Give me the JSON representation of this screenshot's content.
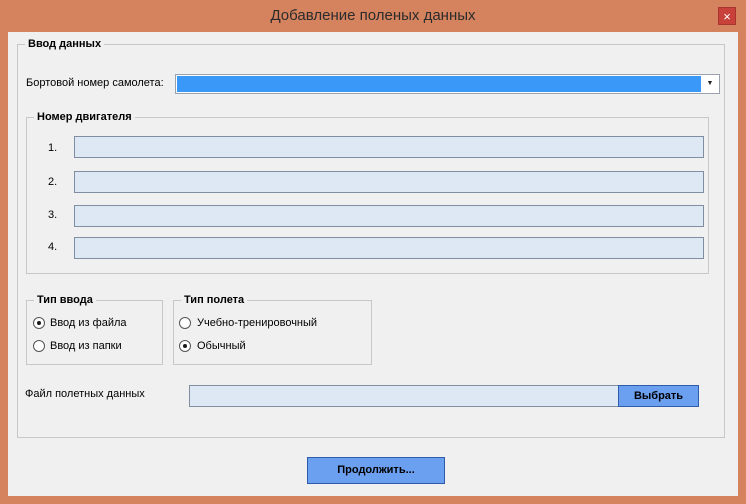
{
  "window": {
    "title": "Добавление поленых данных",
    "close_glyph": "×"
  },
  "input_group": {
    "legend": "Ввод данных",
    "tail_number_label": "Бортовой номер самолета:",
    "tail_number_value": "",
    "dropdown_glyph": "▼"
  },
  "engine_group": {
    "legend": "Номер двигателя",
    "rows": [
      {
        "label": "1.",
        "value": ""
      },
      {
        "label": "2.",
        "value": ""
      },
      {
        "label": "3.",
        "value": ""
      },
      {
        "label": "4.",
        "value": ""
      }
    ]
  },
  "input_type_group": {
    "legend": "Тип ввода",
    "options": [
      {
        "label": "Ввод из файла",
        "selected": true
      },
      {
        "label": "Ввод из папки",
        "selected": false
      }
    ]
  },
  "flight_type_group": {
    "legend": "Тип полета",
    "options": [
      {
        "label": "Учебно-тренировочный",
        "selected": false
      },
      {
        "label": "Обычный",
        "selected": true
      }
    ]
  },
  "file_row": {
    "label": "Файл полетных данных",
    "value": "",
    "browse_label": "Выбрать"
  },
  "footer": {
    "continue_label": "Продолжить..."
  },
  "colors": {
    "title_bar": "#d5835f",
    "client_bg": "#f0f0f0",
    "field_fill": "#dde8f4",
    "selection": "#3a99f8",
    "button": "#6b9ff0"
  }
}
